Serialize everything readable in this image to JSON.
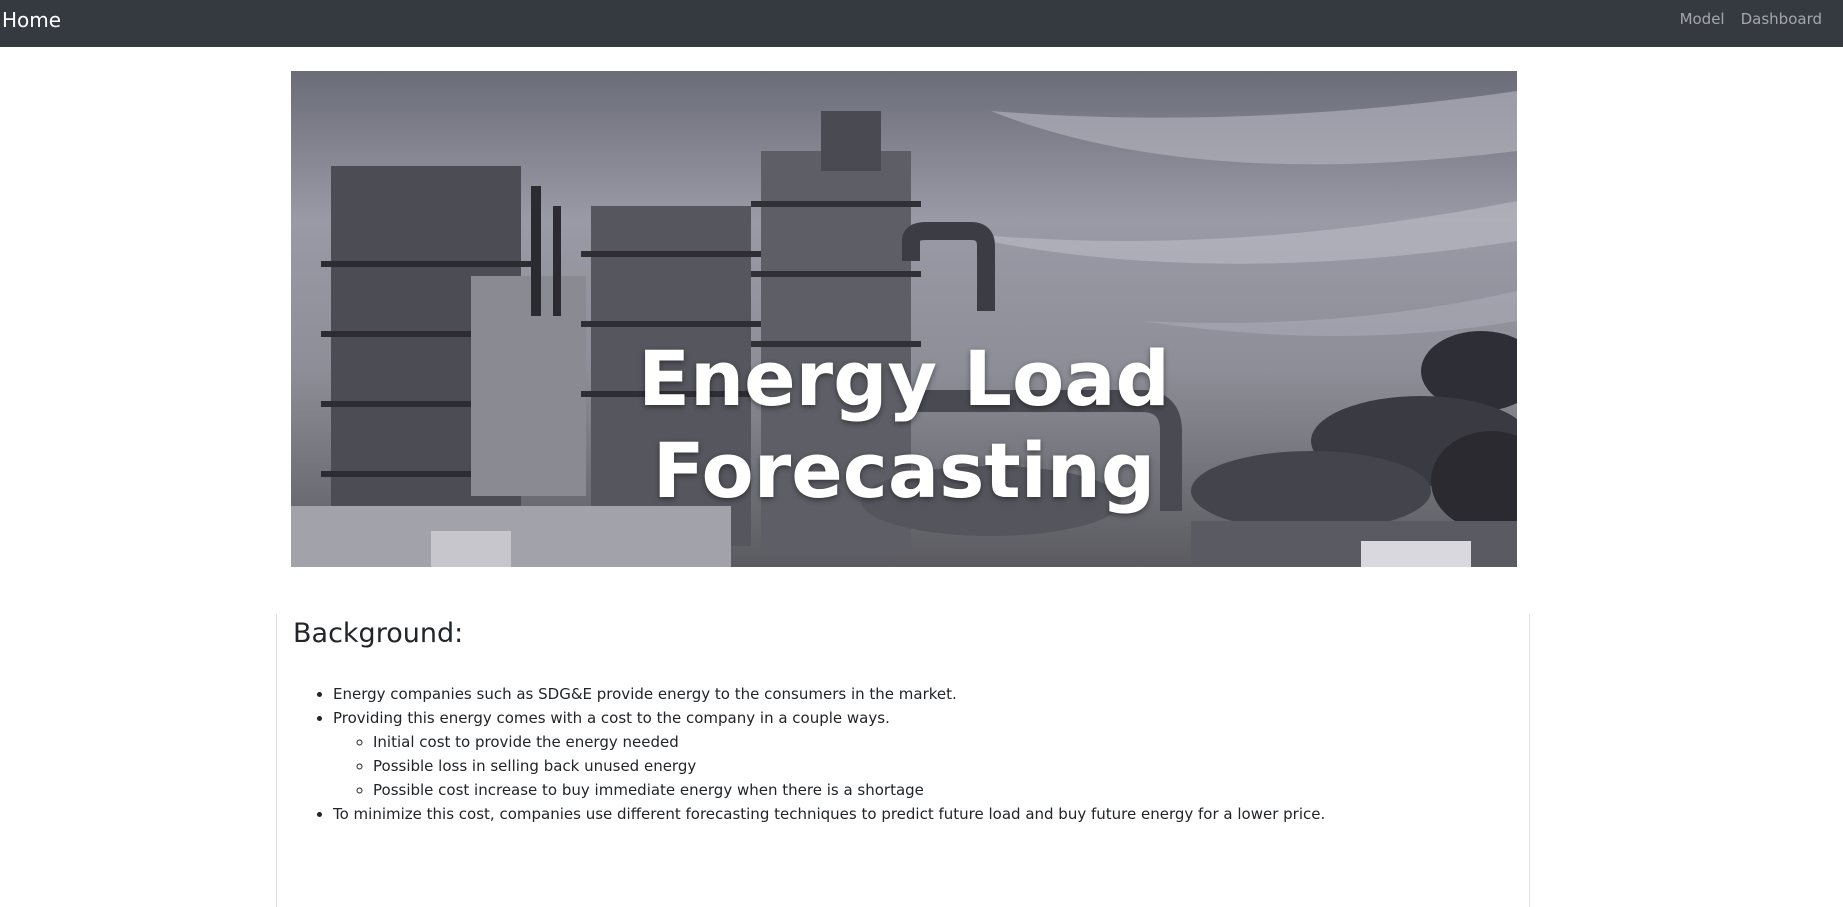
{
  "navbar": {
    "brand": "Home",
    "links": [
      "Model",
      "Dashboard"
    ]
  },
  "hero": {
    "title_line1": "Energy Load",
    "title_line2": "Forecasting"
  },
  "background": {
    "heading": "Background:",
    "bullet_1": "Energy companies such as SDG&E provide energy to the consumers in the market.",
    "bullet_2": "Providing this energy comes with a cost to the company in a couple ways.",
    "sub_bullets": [
      "Initial cost to provide the energy needed",
      "Possible loss in selling back unused energy",
      "Possible cost increase to buy immediate energy when there is a shortage"
    ],
    "bullet_3": "To minimize this cost, companies use different forecasting techniques to predict future load and buy future energy for a lower price."
  },
  "colors": {
    "navbar_bg": "#343a40",
    "text": "#212529"
  }
}
